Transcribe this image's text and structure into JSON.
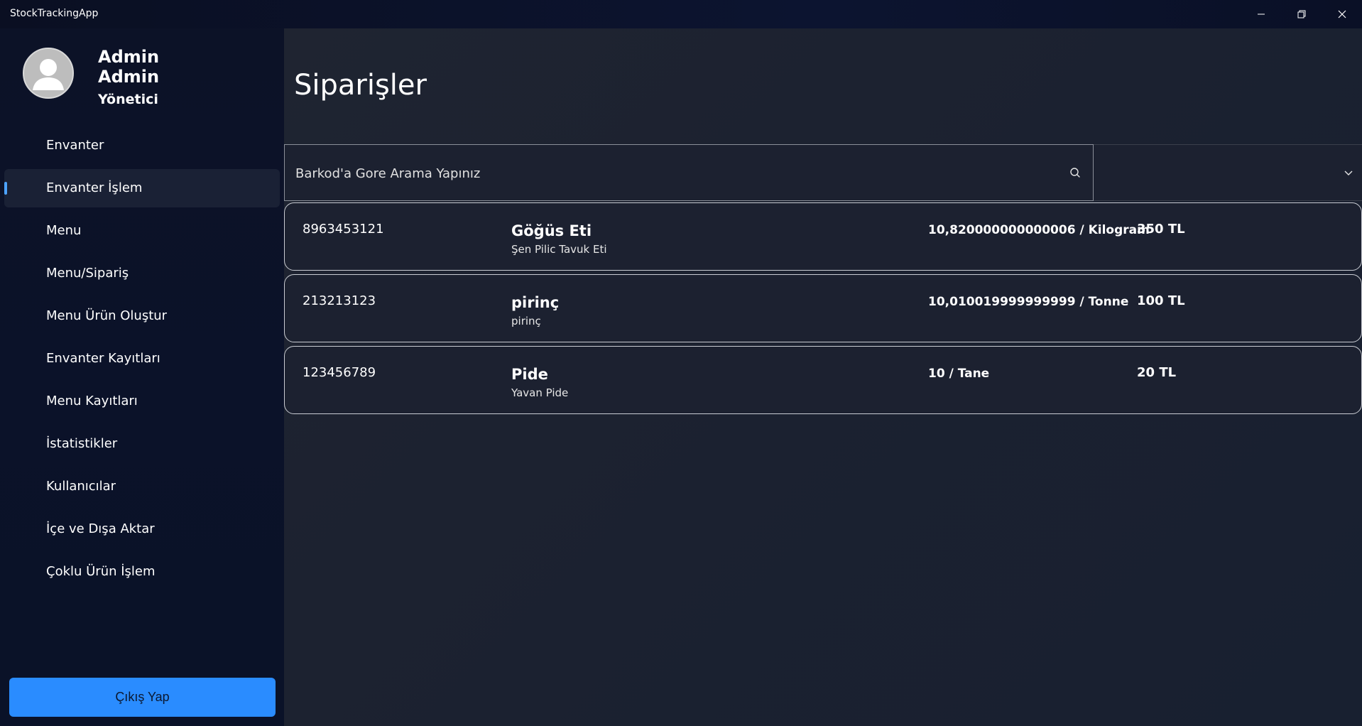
{
  "window": {
    "title": "StockTrackingApp"
  },
  "user": {
    "first_name": "Admin",
    "last_name": "Admin",
    "role": "Yönetici"
  },
  "sidebar": {
    "items": [
      {
        "label": "Envanter",
        "active": false
      },
      {
        "label": "Envanter İşlem",
        "active": true
      },
      {
        "label": "Menu",
        "active": false
      },
      {
        "label": "Menu/Sipariş",
        "active": false
      },
      {
        "label": "Menu Ürün Oluştur",
        "active": false
      },
      {
        "label": "Envanter Kayıtları",
        "active": false
      },
      {
        "label": "Menu Kayıtları",
        "active": false
      },
      {
        "label": "İstatistikler",
        "active": false
      },
      {
        "label": "Kullanıcılar",
        "active": false
      },
      {
        "label": "İçe ve Dışa Aktar",
        "active": false
      },
      {
        "label": "Çoklu Ürün İşlem",
        "active": false
      }
    ],
    "logout_label": "Çıkış Yap"
  },
  "main": {
    "title": "Siparişler",
    "search": {
      "placeholder": "Barkod'a Gore Arama Yapınız",
      "value": ""
    },
    "dropdown": {
      "selected": ""
    },
    "orders": [
      {
        "barcode": "8963453121",
        "name": "Göğüs Eti",
        "description": "Şen Pilic Tavuk Eti",
        "quantity": "10,820000000000006 / Kilogram",
        "price": "350 TL"
      },
      {
        "barcode": "213213123",
        "name": "pirinç",
        "description": "pirinç",
        "quantity": "10,010019999999999 / Tonne",
        "price": "100 TL"
      },
      {
        "barcode": "123456789",
        "name": "Pide",
        "description": "Yavan Pide",
        "quantity": "10 / Tane",
        "price": "20 TL"
      }
    ]
  },
  "colors": {
    "accent": "#4da3ff",
    "logout_button": "#2a8cff",
    "sidebar_bg": "#0c1227",
    "main_bg": "#1f2431",
    "row_border": "#c9ccd3"
  },
  "icons": {
    "avatar": "person-icon",
    "search": "search-icon",
    "dropdown": "chevron-down-icon",
    "minimize": "minimize-icon",
    "restore": "restore-icon",
    "close": "close-icon"
  }
}
